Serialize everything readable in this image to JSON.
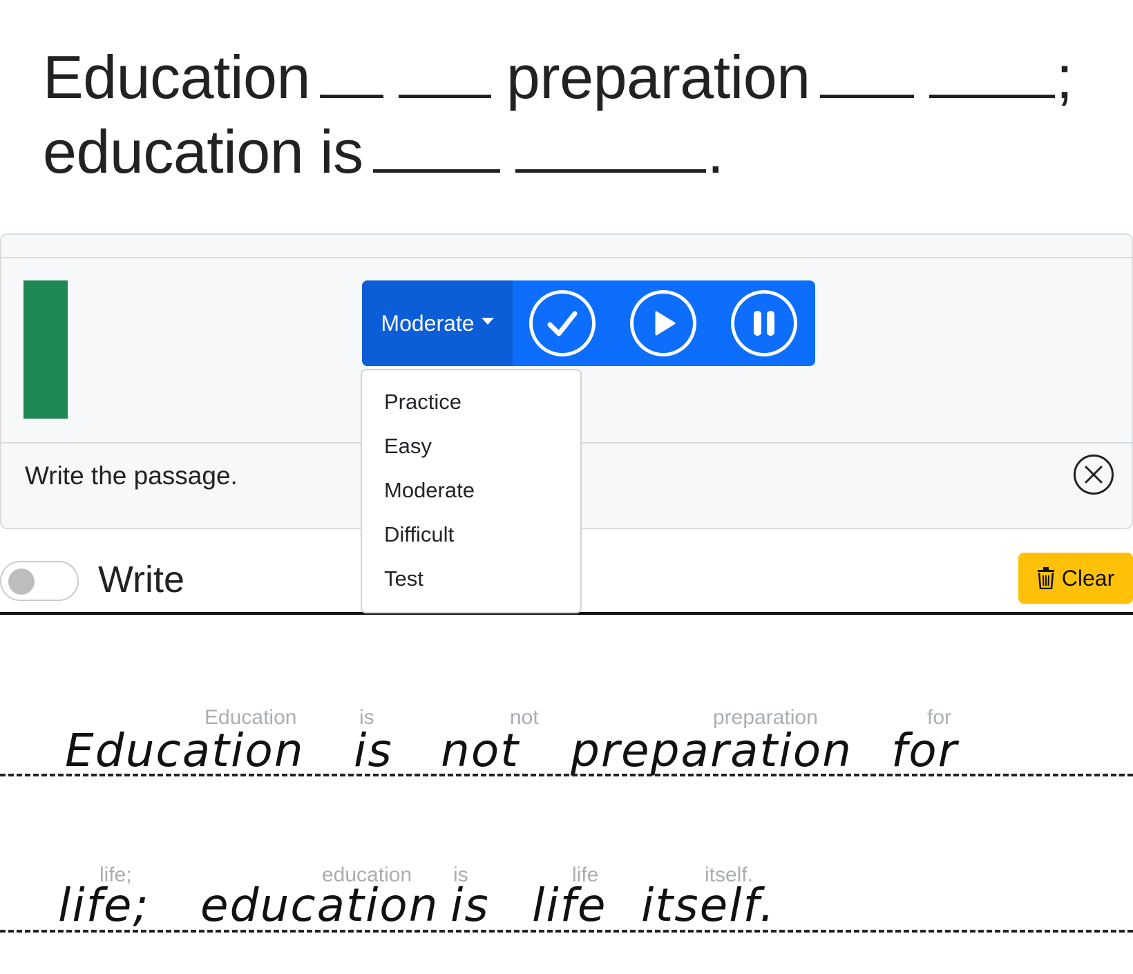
{
  "prompt": {
    "line1": [
      "Education",
      "preparation"
    ],
    "line2": [
      "education is"
    ],
    "semicolon": ";",
    "period": "."
  },
  "controls": {
    "level_label": "Moderate",
    "check_icon": "check-circle-icon",
    "play_icon": "play-circle-icon",
    "pause_icon": "pause-circle-icon",
    "accent": "#0d6efd",
    "accent_dark": "#0b5ed7",
    "indicator_color": "#1e8754"
  },
  "dropdown": {
    "options": [
      "Practice",
      "Easy",
      "Moderate",
      "Difficult",
      "Test"
    ]
  },
  "instruction": "Write the passage.",
  "toolbar": {
    "toggle_label": "Write",
    "toggle_on": false,
    "clear_label": "Clear",
    "clear_color": "#ffc107"
  },
  "writing": {
    "line1": {
      "hints": [
        "Education",
        "is",
        "not",
        "preparation",
        "for"
      ],
      "handwriting": [
        "Education",
        "is",
        "not",
        "preparation",
        "for"
      ]
    },
    "line2": {
      "hints": [
        "life;",
        "education",
        "is",
        "life",
        "itself."
      ],
      "handwriting": [
        "life;",
        "education",
        "is",
        "life",
        "itself."
      ]
    }
  }
}
